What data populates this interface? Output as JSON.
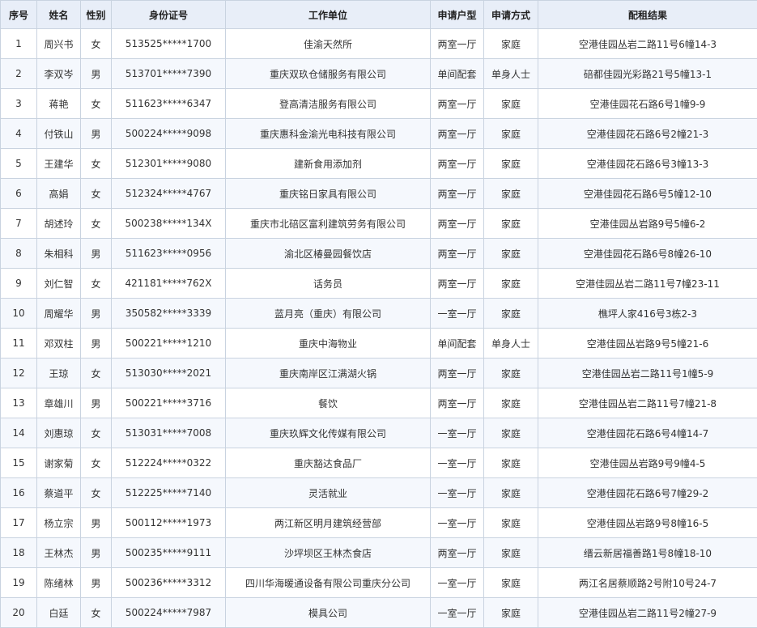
{
  "table": {
    "headers": [
      "序号",
      "姓名",
      "性别",
      "身份证号",
      "工作单位",
      "申请户型",
      "申请方式",
      "配租结果"
    ],
    "rows": [
      [
        "1",
        "周兴书",
        "女",
        "513525*****1700",
        "佳渝天然所",
        "两室一厅",
        "家庭",
        "空港佳园丛岩二路11号6幢14-3"
      ],
      [
        "2",
        "李双岑",
        "男",
        "513701*****7390",
        "重庆双玖仓储服务有限公司",
        "单间配套",
        "单身人士",
        "碚都佳园光彩路21号5幢13-1"
      ],
      [
        "3",
        "蒋艳",
        "女",
        "511623*****6347",
        "登高清洁服务有限公司",
        "两室一厅",
        "家庭",
        "空港佳园花石路6号1幢9-9"
      ],
      [
        "4",
        "付铁山",
        "男",
        "500224*****9098",
        "重庆惠科金渝光电科技有限公司",
        "两室一厅",
        "家庭",
        "空港佳园花石路6号2幢21-3"
      ],
      [
        "5",
        "王建华",
        "女",
        "512301*****9080",
        "建新食用添加剂",
        "两室一厅",
        "家庭",
        "空港佳园花石路6号3幢13-3"
      ],
      [
        "6",
        "高娟",
        "女",
        "512324*****4767",
        "重庆铭日家具有限公司",
        "两室一厅",
        "家庭",
        "空港佳园花石路6号5幢12-10"
      ],
      [
        "7",
        "胡述玲",
        "女",
        "500238*****134X",
        "重庆市北碚区富利建筑劳务有限公司",
        "两室一厅",
        "家庭",
        "空港佳园丛岩路9号5幢6-2"
      ],
      [
        "8",
        "朱相科",
        "男",
        "511623*****0956",
        "渝北区椿曼园餐饮店",
        "两室一厅",
        "家庭",
        "空港佳园花石路6号8幢26-10"
      ],
      [
        "9",
        "刘仁智",
        "女",
        "421181*****762X",
        "话务员",
        "两室一厅",
        "家庭",
        "空港佳园丛岩二路11号7幢23-11"
      ],
      [
        "10",
        "周耀华",
        "男",
        "350582*****3339",
        "蓝月亮（重庆）有限公司",
        "一室一厅",
        "家庭",
        "樵坪人家416号3栋2-3"
      ],
      [
        "11",
        "邓双柱",
        "男",
        "500221*****1210",
        "重庆中海物业",
        "单间配套",
        "单身人士",
        "空港佳园丛岩路9号5幢21-6"
      ],
      [
        "12",
        "王琼",
        "女",
        "513030*****2021",
        "重庆南岸区江满湖火锅",
        "两室一厅",
        "家庭",
        "空港佳园丛岩二路11号1幢5-9"
      ],
      [
        "13",
        "章雄川",
        "男",
        "500221*****3716",
        "餐饮",
        "两室一厅",
        "家庭",
        "空港佳园丛岩二路11号7幢21-8"
      ],
      [
        "14",
        "刘惠琼",
        "女",
        "513031*****7008",
        "重庆玖辉文化传媒有限公司",
        "一室一厅",
        "家庭",
        "空港佳园花石路6号4幢14-7"
      ],
      [
        "15",
        "谢家菊",
        "女",
        "512224*****0322",
        "重庆豁达食品厂",
        "一室一厅",
        "家庭",
        "空港佳园丛岩路9号9幢4-5"
      ],
      [
        "16",
        "蔡道平",
        "女",
        "512225*****7140",
        "灵活就业",
        "一室一厅",
        "家庭",
        "空港佳园花石路6号7幢29-2"
      ],
      [
        "17",
        "杨立宗",
        "男",
        "500112*****1973",
        "两江新区明月建筑经营部",
        "一室一厅",
        "家庭",
        "空港佳园丛岩路9号8幢16-5"
      ],
      [
        "18",
        "王林杰",
        "男",
        "500235*****9111",
        "沙坪坝区王林杰食店",
        "两室一厅",
        "家庭",
        "缙云新居福善路1号8幢18-10"
      ],
      [
        "19",
        "陈绪林",
        "男",
        "500236*****3312",
        "四川华海暖通设备有限公司重庆分公司",
        "一室一厅",
        "家庭",
        "两江名居蔡顺路2号附10号24-7"
      ],
      [
        "20",
        "白廷",
        "女",
        "500224*****7987",
        "模具公司",
        "一室一厅",
        "家庭",
        "空港佳园丛岩二路11号2幢27-9"
      ]
    ]
  }
}
